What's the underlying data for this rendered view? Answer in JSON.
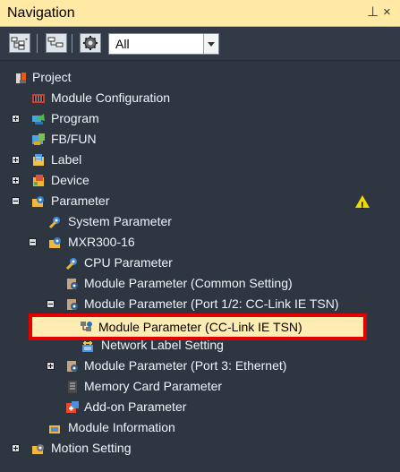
{
  "panel": {
    "title": "Navigation",
    "pin_icon": "pin-icon",
    "close_icon": "close-icon"
  },
  "toolbar": {
    "buttons": [
      {
        "name": "toggle-view-button",
        "icon": "tree-expand-icon"
      },
      {
        "name": "collapse-tree-button",
        "icon": "tree-collapse-icon"
      },
      {
        "name": "settings-button",
        "icon": "gear-icon"
      }
    ],
    "filter": {
      "selected": "All"
    }
  },
  "tree": {
    "items": [
      {
        "label": "Project",
        "icon": "project-icon",
        "expanded": null
      },
      {
        "label": "Module Configuration",
        "icon": "module-configuration-icon",
        "expanded": null
      },
      {
        "label": "Program",
        "icon": "program-icon",
        "expanded": false
      },
      {
        "label": "FB/FUN",
        "icon": "fb-fun-icon",
        "expanded": null
      },
      {
        "label": "Label",
        "icon": "label-icon",
        "expanded": false
      },
      {
        "label": "Device",
        "icon": "device-icon",
        "expanded": false
      },
      {
        "label": "Parameter",
        "icon": "parameter-icon",
        "expanded": true,
        "status_icon": "warning-icon"
      },
      {
        "label": "System Parameter",
        "icon": "system-parameter-icon",
        "expanded": null
      },
      {
        "label": "MXR300-16",
        "icon": "module-icon",
        "expanded": true
      },
      {
        "label": "CPU Parameter",
        "icon": "cpu-parameter-icon",
        "expanded": null
      },
      {
        "label": "Module Parameter (Common Setting)",
        "icon": "module-parameter-icon",
        "expanded": null
      },
      {
        "label": "Module Parameter (Port 1/2: CC-Link IE TSN)",
        "icon": "module-parameter-icon",
        "expanded": true
      },
      {
        "label": "Module Parameter (CC-Link IE TSN)",
        "icon": "network-parameter-icon",
        "expanded": null,
        "selected": true
      },
      {
        "label": "Network Label Setting",
        "icon": "network-label-icon",
        "expanded": null
      },
      {
        "label": "Module Parameter (Port 3: Ethernet)",
        "icon": "module-parameter-icon",
        "expanded": false
      },
      {
        "label": "Memory Card Parameter",
        "icon": "memory-card-icon",
        "expanded": null
      },
      {
        "label": "Add-on Parameter",
        "icon": "add-on-parameter-icon",
        "expanded": null
      },
      {
        "label": "Module Information",
        "icon": "module-information-icon",
        "expanded": null
      },
      {
        "label": "Motion Setting",
        "icon": "motion-setting-icon",
        "expanded": false
      }
    ]
  },
  "colors": {
    "background": "#2e3642",
    "title_bar": "#ffe9a4",
    "selection": "#ffecb3",
    "highlight_outline": "#e50000",
    "warning": "#f0db00"
  }
}
